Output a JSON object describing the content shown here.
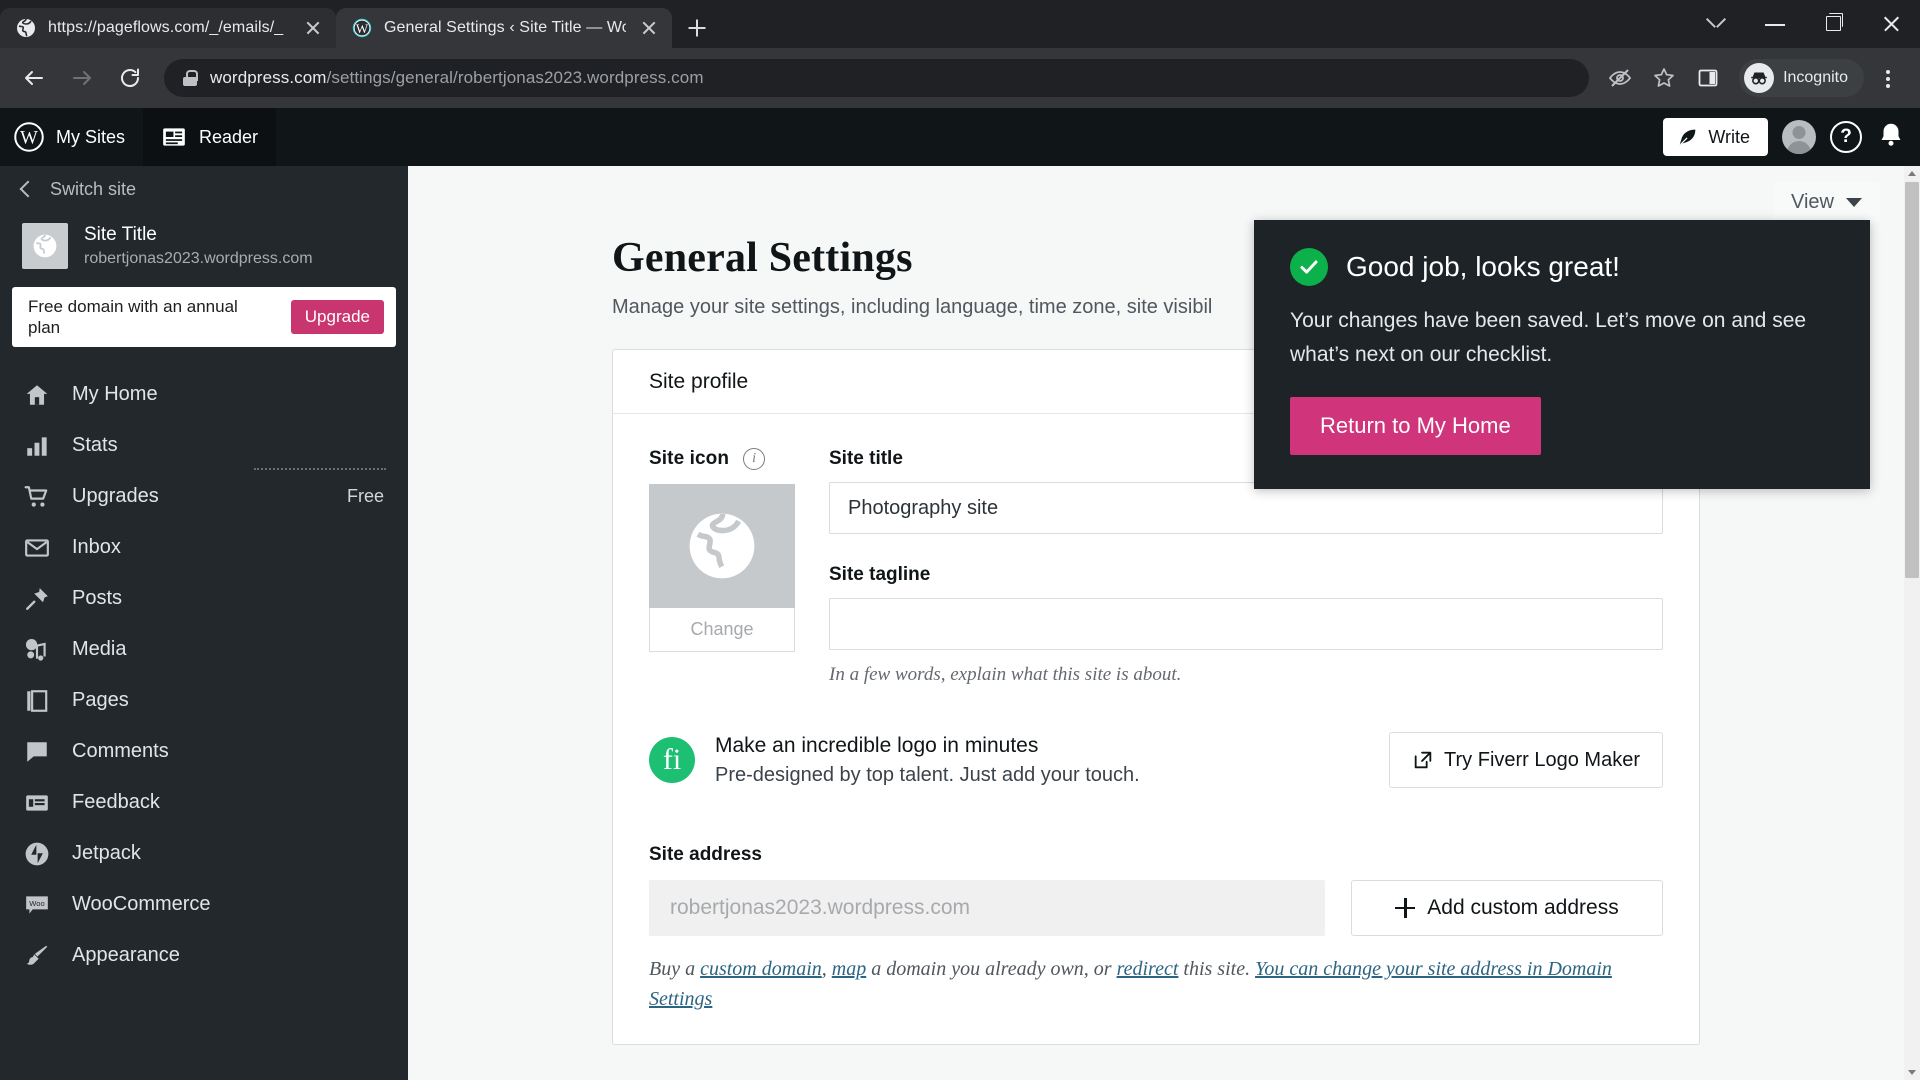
{
  "browser": {
    "tabs": [
      {
        "title": "https://pageflows.com/_/emails/_",
        "favicon": "globe-icon",
        "active": false
      },
      {
        "title": "General Settings ‹ Site Title — Wo",
        "favicon": "wordpress-icon",
        "active": true
      }
    ],
    "new_tab_label": "+",
    "window_controls": [
      "chevron-down",
      "minimize",
      "maximize",
      "close"
    ],
    "address_bar": {
      "domain": "wordpress.com",
      "path": "/settings/general/robertjonas2023.wordpress.com",
      "security": "lock-icon"
    },
    "toolbar_icons": [
      "third-party-cookie-blocked-icon",
      "bookmark-star-icon",
      "side-panel-icon"
    ],
    "profile_chip": "Incognito",
    "menu": "kebab-menu-icon"
  },
  "masterbar": {
    "my_sites": "My Sites",
    "reader": "Reader",
    "write": "Write",
    "avatar": "user-avatar",
    "help": "?",
    "notifications": "bell-icon"
  },
  "sidebar": {
    "switch_site": "Switch site",
    "site_name": "Site Title",
    "site_url": "robertjonas2023.wordpress.com",
    "upsell": {
      "text": "Free domain with an annual plan",
      "button": "Upgrade"
    },
    "items": [
      {
        "label": "My Home",
        "icon": "home-icon",
        "badge": ""
      },
      {
        "label": "Stats",
        "icon": "bar-chart-icon",
        "badge": ""
      },
      {
        "label": "Upgrades",
        "icon": "cart-icon",
        "badge": "Free"
      },
      {
        "label": "Inbox",
        "icon": "envelope-icon",
        "badge": ""
      },
      {
        "label": "Posts",
        "icon": "pin-icon",
        "badge": ""
      },
      {
        "label": "Media",
        "icon": "media-icon",
        "badge": ""
      },
      {
        "label": "Pages",
        "icon": "pages-icon",
        "badge": ""
      },
      {
        "label": "Comments",
        "icon": "comment-icon",
        "badge": ""
      },
      {
        "label": "Feedback",
        "icon": "feedback-icon",
        "badge": ""
      },
      {
        "label": "Jetpack",
        "icon": "jetpack-icon",
        "badge": ""
      },
      {
        "label": "WooCommerce",
        "icon": "woocommerce-icon",
        "badge": ""
      },
      {
        "label": "Appearance",
        "icon": "brush-icon",
        "badge": ""
      }
    ]
  },
  "main": {
    "view_dropdown": "View",
    "title": "General Settings",
    "subtitle": "Manage your site settings, including language, time zone, site visibil",
    "card_title": "Site profile",
    "site_icon_label": "Site icon",
    "change_button": "Change",
    "site_title_label": "Site title",
    "site_title_value": "Photography site",
    "site_tagline_label": "Site tagline",
    "site_tagline_value": "",
    "site_tagline_hint": "In a few words, explain what this site is about.",
    "promo": {
      "heading": "Make an incredible logo in minutes",
      "subheading": "Pre-designed by top talent. Just add your touch.",
      "button": "Try Fiverr Logo Maker"
    },
    "site_address_label": "Site address",
    "site_address_value": "robertjonas2023.wordpress.com",
    "add_custom_address_button": "Add custom address",
    "address_note": {
      "p1": "Buy a ",
      "link1": "custom domain",
      "p2": ", ",
      "link2": "map",
      "p3": " a domain you already own, or ",
      "link3": "redirect",
      "p4": " this site. ",
      "link4": "You can change your site address in Domain Settings"
    }
  },
  "notice": {
    "icon": "success-check-icon",
    "title": "Good job, looks great!",
    "body": "Your changes have been saved. Let’s move on and see what’s next on our checklist.",
    "cta": "Return to My Home"
  },
  "colors": {
    "accent_pink": "#d0347a",
    "upgrade_pink": "#c9356e",
    "success_green": "#0cb14b",
    "fiverr_green": "#1dbf73",
    "sidebar_bg": "#23282d",
    "masterbar_bg": "#101517",
    "notice_bg": "#1d2327"
  }
}
